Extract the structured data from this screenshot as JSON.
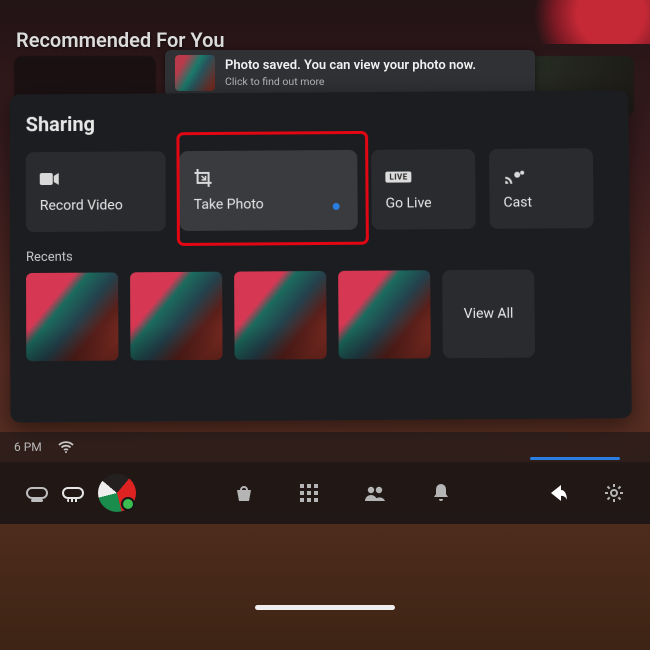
{
  "header": {
    "recommended_label": "Recommended For You"
  },
  "toast": {
    "title": "Photo saved. You can view your photo now.",
    "subtitle": "Click to find out more"
  },
  "panel": {
    "title": "Sharing",
    "cards": {
      "record_label": "Record Video",
      "photo_label": "Take Photo",
      "live_label": "Go Live",
      "cast_label": "Cast",
      "live_badge": "LIVE"
    },
    "recents_label": "Recents",
    "viewall_label": "View All"
  },
  "status": {
    "time": "6 PM"
  },
  "icons": {
    "camcorder": "camcorder-icon",
    "photo": "photo-crop-icon",
    "cast": "cast-icon",
    "wifi": "wifi-icon",
    "shop": "shop-icon",
    "apps": "apps-grid-icon",
    "people": "people-icon",
    "bell": "bell-icon",
    "share": "share-icon",
    "gear": "gear-icon"
  }
}
